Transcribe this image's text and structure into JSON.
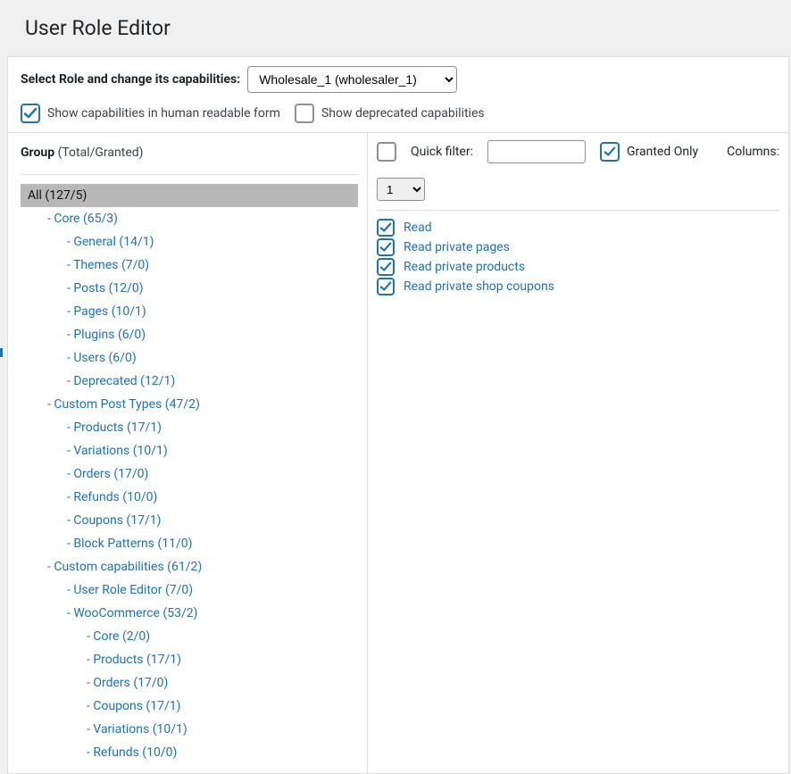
{
  "page": {
    "title": "User Role Editor"
  },
  "top": {
    "select_label": "Select Role and change its capabilities:",
    "role_value": "Wholesale_1 (wholesaler_1)",
    "show_human_label": "Show capabilities in human readable form",
    "show_deprecated_label": "Show deprecated capabilities",
    "show_human_checked": true,
    "show_deprecated_checked": false
  },
  "group": {
    "title": "Group",
    "sub": "(Total/Granted)",
    "items": [
      {
        "label": "All (127/5)",
        "depth": 0,
        "selected": true,
        "dash": false
      },
      {
        "label": "Core (65/3)",
        "depth": 1,
        "dash": true
      },
      {
        "label": "General (14/1)",
        "depth": 2,
        "dash": true
      },
      {
        "label": "Themes (7/0)",
        "depth": 2,
        "dash": true
      },
      {
        "label": "Posts (12/0)",
        "depth": 2,
        "dash": true
      },
      {
        "label": "Pages (10/1)",
        "depth": 2,
        "dash": true
      },
      {
        "label": "Plugins (6/0)",
        "depth": 2,
        "dash": true
      },
      {
        "label": "Users (6/0)",
        "depth": 2,
        "dash": true
      },
      {
        "label": "Deprecated (12/1)",
        "depth": 2,
        "dash": true
      },
      {
        "label": "Custom Post Types (47/2)",
        "depth": 1,
        "dash": true
      },
      {
        "label": "Products (17/1)",
        "depth": 2,
        "dash": true
      },
      {
        "label": "Variations (10/1)",
        "depth": 2,
        "dash": true
      },
      {
        "label": "Orders (17/0)",
        "depth": 2,
        "dash": true
      },
      {
        "label": "Refunds (10/0)",
        "depth": 2,
        "dash": true
      },
      {
        "label": "Coupons (17/1)",
        "depth": 2,
        "dash": true
      },
      {
        "label": "Block Patterns (11/0)",
        "depth": 2,
        "dash": true
      },
      {
        "label": "Custom capabilities (61/2)",
        "depth": 1,
        "dash": true
      },
      {
        "label": "User Role Editor (7/0)",
        "depth": 2,
        "dash": true
      },
      {
        "label": "WooCommerce (53/2)",
        "depth": 2,
        "dash": true
      },
      {
        "label": "Core (2/0)",
        "depth": 3,
        "dash": true
      },
      {
        "label": "Products (17/1)",
        "depth": 3,
        "dash": true
      },
      {
        "label": "Orders (17/0)",
        "depth": 3,
        "dash": true
      },
      {
        "label": "Coupons (17/1)",
        "depth": 3,
        "dash": true
      },
      {
        "label": "Variations (10/1)",
        "depth": 3,
        "dash": true
      },
      {
        "label": "Refunds (10/0)",
        "depth": 3,
        "dash": true
      }
    ]
  },
  "right": {
    "toggle_all_checked": false,
    "quick_filter_label": "Quick filter:",
    "quick_filter_value": "",
    "granted_only_label": "Granted Only",
    "granted_only_checked": true,
    "columns_label": "Columns:",
    "columns_value": "1"
  },
  "caps": [
    {
      "label": "Read",
      "checked": true
    },
    {
      "label": "Read private pages",
      "checked": true
    },
    {
      "label": "Read private products",
      "checked": true
    },
    {
      "label": "Read private shop coupons",
      "checked": true
    }
  ]
}
